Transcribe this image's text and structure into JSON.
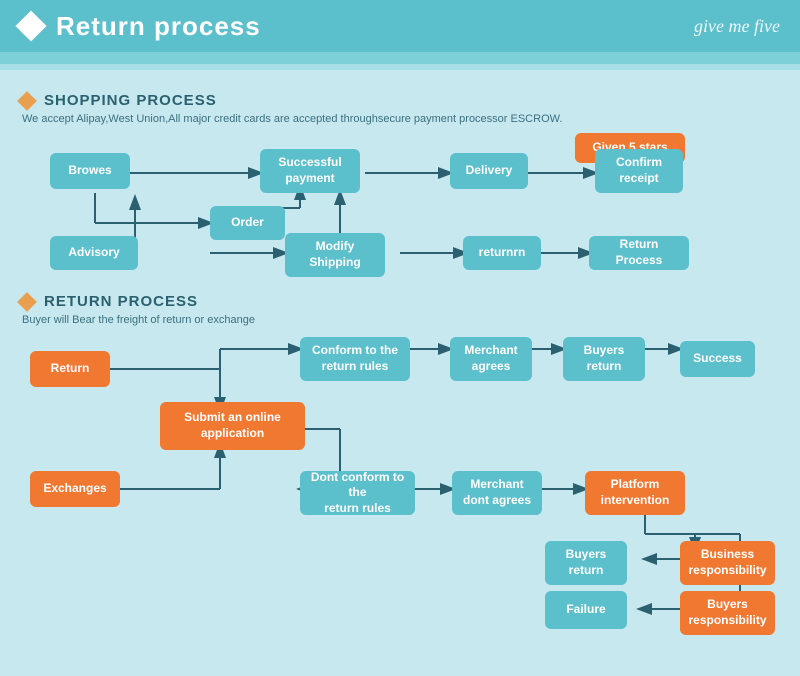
{
  "header": {
    "title": "Return process",
    "brand": "give me five"
  },
  "shopping_section": {
    "title": "SHOPPING PROCESS",
    "subtitle": "We accept Alipay,West Union,All major credit cards are accepted throughsecure payment processor ESCROW.",
    "boxes": {
      "browes": "Browes",
      "order": "Order",
      "advisory": "Advisory",
      "modify_shipping": "Modify\nShipping",
      "successful_payment": "Successful\npayment",
      "delivery": "Delivery",
      "confirm_receipt": "Confirm\nreceipt",
      "given_5_stars": "Given 5 stars",
      "returnrn": "returnrn",
      "return_process": "Return Process"
    }
  },
  "return_section": {
    "title": "RETURN PROCESS",
    "subtitle": "Buyer will Bear the freight of return or exchange",
    "boxes": {
      "return_btn": "Return",
      "exchanges": "Exchanges",
      "submit_online": "Submit an online\napplication",
      "conform_rules": "Conform to the\nreturn rules",
      "dont_conform_rules": "Dont conform to the\nreturn rules",
      "merchant_agrees": "Merchant\nagrees",
      "merchant_dont_agrees": "Merchant\ndont agrees",
      "buyers_return1": "Buyers\nreturn",
      "buyers_return2": "Buyers\nreturn",
      "platform_intervention": "Platform\nintervention",
      "success": "Success",
      "business_responsibility": "Business\nresponsibility",
      "buyers_responsibility": "Buyers\nresponsibility",
      "failure": "Failure"
    }
  }
}
